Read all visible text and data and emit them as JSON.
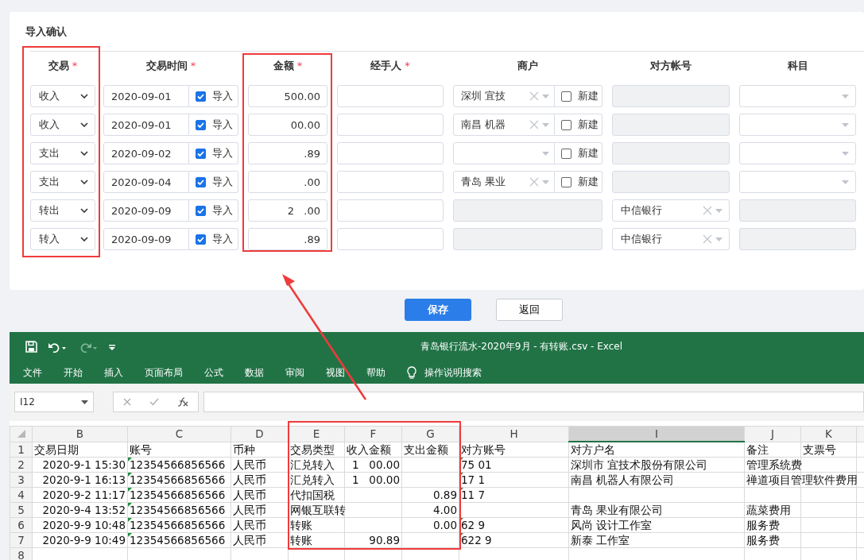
{
  "form": {
    "title": "导入确认",
    "columns": [
      {
        "label": "交易",
        "required_mark": "*"
      },
      {
        "label": "交易时间",
        "required_mark": "*"
      },
      {
        "label": "金额",
        "required_mark": "*"
      },
      {
        "label": "经手人",
        "required_mark": "*"
      },
      {
        "label": "商户"
      },
      {
        "label": "对方帐号"
      },
      {
        "label": "科目"
      }
    ],
    "rows": [
      {
        "type": "收入",
        "date": "2020-09-01",
        "import": {
          "label": "导入",
          "checked": true
        },
        "amount": "500.00",
        "merchant": {
          "disabled": false,
          "value": "深圳 宜技",
          "new_label": "新建",
          "new_checked": false
        },
        "account": {
          "disabled": true
        },
        "subject": {
          "disabled": false
        }
      },
      {
        "type": "收入",
        "date": "2020-09-01",
        "import": {
          "label": "导入",
          "checked": true
        },
        "amount": "00.00",
        "merchant": {
          "disabled": false,
          "value": "南昌 机器",
          "new_label": "新建",
          "new_checked": false
        },
        "account": {
          "disabled": true
        },
        "subject": {
          "disabled": false
        }
      },
      {
        "type": "支出",
        "date": "2020-09-02",
        "import": {
          "label": "导入",
          "checked": true
        },
        "amount": ".89",
        "merchant": {
          "disabled": false,
          "new_label": "新建",
          "new_checked": false
        },
        "account": {
          "disabled": true
        },
        "subject": {
          "disabled": false
        }
      },
      {
        "type": "支出",
        "date": "2020-09-04",
        "import": {
          "label": "导入",
          "checked": true
        },
        "amount": ".00",
        "merchant": {
          "disabled": false,
          "value": "青岛 果业",
          "new_label": "新建",
          "new_checked": false
        },
        "account": {
          "disabled": true
        },
        "subject": {
          "disabled": false
        }
      },
      {
        "type": "转出",
        "date": "2020-09-09",
        "import": {
          "label": "导入",
          "checked": true
        },
        "amount": "2   .00",
        "merchant": {
          "disabled": true
        },
        "account": {
          "disabled": false,
          "value": "中信银行"
        },
        "subject": {
          "disabled": true
        }
      },
      {
        "type": "转入",
        "date": "2020-09-09",
        "import": {
          "label": "导入",
          "checked": true
        },
        "amount": ".89",
        "merchant": {
          "disabled": true
        },
        "account": {
          "disabled": false,
          "value": "中信银行"
        },
        "subject": {
          "disabled": true
        }
      }
    ]
  },
  "buttons": [
    {
      "label": "保存",
      "kind": "primary"
    },
    {
      "label": "返回",
      "kind": "default"
    }
  ],
  "excel": {
    "title": "青岛银行流水-2020年9月 - 有转账.csv  -  Excel",
    "menu": [
      "文件",
      "开始",
      "插入",
      "页面布局",
      "公式",
      "数据",
      "审阅",
      "视图",
      "帮助"
    ],
    "tell_me": "操作说明搜索",
    "name_box": "I12",
    "columns": [
      {
        "label": "B",
        "selected": false
      },
      {
        "label": "C",
        "selected": false
      },
      {
        "label": "D",
        "selected": false
      },
      {
        "label": "E",
        "selected": false
      },
      {
        "label": "F",
        "selected": false
      },
      {
        "label": "G",
        "selected": false
      },
      {
        "label": "H",
        "selected": false
      },
      {
        "label": "I",
        "selected": true
      },
      {
        "label": "J",
        "selected": false
      },
      {
        "label": "K",
        "selected": false
      }
    ],
    "rows": [
      {
        "number": "1",
        "cells": [
          "交易日期",
          "账号",
          "币种",
          "交易类型",
          "收入金额",
          "支出金额",
          "对方账号",
          "对方户名",
          "备注",
          "支票号"
        ]
      },
      {
        "number": "2",
        "cells": [
          {
            "text": "2020-9-1 15:30",
            "kind": "number"
          },
          {
            "text": "12354566856566",
            "kind": "flagged"
          },
          "人民币",
          "汇兑转入",
          {
            "text": "1   00.00",
            "kind": "number"
          },
          "",
          {
            "text": "75 01",
            "kind": "flagged"
          },
          "深圳市 宜技术股份有限公司",
          "管理系统费",
          ""
        ]
      },
      {
        "number": "3",
        "cells": [
          {
            "text": "2020-9-1 16:13",
            "kind": "number"
          },
          {
            "text": "12354566856566",
            "kind": "flagged"
          },
          "人民币",
          "汇兑转入",
          {
            "text": "1   00.00",
            "kind": "number"
          },
          "",
          {
            "text": "17 1",
            "kind": "flagged"
          },
          "南昌 机器人有限公司",
          "禅道项目管理软件费用",
          ""
        ]
      },
      {
        "number": "4",
        "cells": [
          {
            "text": "2020-9-2 11:17",
            "kind": "number"
          },
          {
            "text": "12354566856566",
            "kind": "flagged"
          },
          "人民币",
          "代扣国税",
          "",
          {
            "text": "0.89",
            "kind": "number"
          },
          {
            "text": "11 7",
            "kind": "flagged"
          },
          "",
          "",
          ""
        ]
      },
      {
        "number": "5",
        "cells": [
          {
            "text": "2020-9-4 13:52",
            "kind": "number"
          },
          {
            "text": "12354566856566",
            "kind": "flagged"
          },
          "人民币",
          "网银互联转",
          "",
          {
            "text": "4.00",
            "kind": "number"
          },
          "",
          "青岛 果业有限公司",
          "蔬菜费用",
          ""
        ]
      },
      {
        "number": "6",
        "cells": [
          {
            "text": "2020-9-9 10:48",
            "kind": "number"
          },
          {
            "text": "12354566856566",
            "kind": "flagged"
          },
          "人民币",
          "转账",
          "",
          {
            "text": "0.00",
            "kind": "number"
          },
          {
            "text": "62 9",
            "kind": "flagged"
          },
          "风尚 设计工作室",
          "服务费",
          ""
        ]
      },
      {
        "number": "7",
        "cells": [
          {
            "text": "2020-9-9 10:49",
            "kind": "number"
          },
          {
            "text": "12354566856566",
            "kind": "flagged"
          },
          "人民币",
          "转账",
          {
            "text": "90.89",
            "kind": "number"
          },
          "",
          {
            "text": "622 9",
            "kind": "flagged"
          },
          "新泰 工作室",
          "服务费",
          ""
        ]
      },
      {
        "number": "8",
        "cells": [
          "",
          "",
          "",
          "",
          "",
          "",
          "",
          "",
          "",
          ""
        ]
      }
    ]
  }
}
